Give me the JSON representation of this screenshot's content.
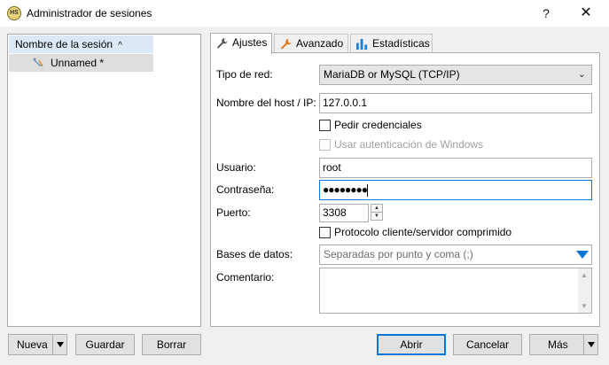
{
  "window": {
    "title": "Administrador de sesiones",
    "app_icon_text": "HS",
    "help_glyph": "?",
    "close_glyph": "✕"
  },
  "sessions": {
    "header": "Nombre de la sesión",
    "sort_glyph": "^",
    "items": [
      {
        "label": "Unnamed *",
        "icon": "session-icon"
      }
    ]
  },
  "tabs": [
    {
      "label": "Ajustes",
      "icon": "wrench-icon",
      "active": true
    },
    {
      "label": "Avanzado",
      "icon": "wrench-orange-icon",
      "active": false
    },
    {
      "label": "Estadísticas",
      "icon": "bar-chart-icon",
      "active": false
    }
  ],
  "form": {
    "network_type": {
      "label": "Tipo de red:",
      "value": "MariaDB or MySQL (TCP/IP)"
    },
    "host": {
      "label": "Nombre del host / IP:",
      "value": "127.0.0.1"
    },
    "prompt_credentials": {
      "label": "Pedir credenciales",
      "checked": false
    },
    "windows_auth": {
      "label": "Usar autenticación de Windows",
      "checked": false,
      "disabled": true
    },
    "user": {
      "label": "Usuario:",
      "value": "root"
    },
    "password": {
      "label": "Contraseña:",
      "value": "●●●●●●●●"
    },
    "port": {
      "label": "Puerto:",
      "value": "3308"
    },
    "compressed": {
      "label": "Protocolo cliente/servidor comprimido",
      "checked": false
    },
    "databases": {
      "label": "Bases de datos:",
      "placeholder": "Separadas por punto y coma (;)"
    },
    "comment": {
      "label": "Comentario:",
      "value": ""
    }
  },
  "buttons": {
    "new": "Nueva",
    "save": "Guardar",
    "delete": "Borrar",
    "open": "Abrir",
    "cancel": "Cancelar",
    "more": "Más"
  },
  "colors": {
    "accent": "#0078d7",
    "dropdown_arrow": "#0a74d4",
    "selection_header": "#dbe9f7"
  }
}
